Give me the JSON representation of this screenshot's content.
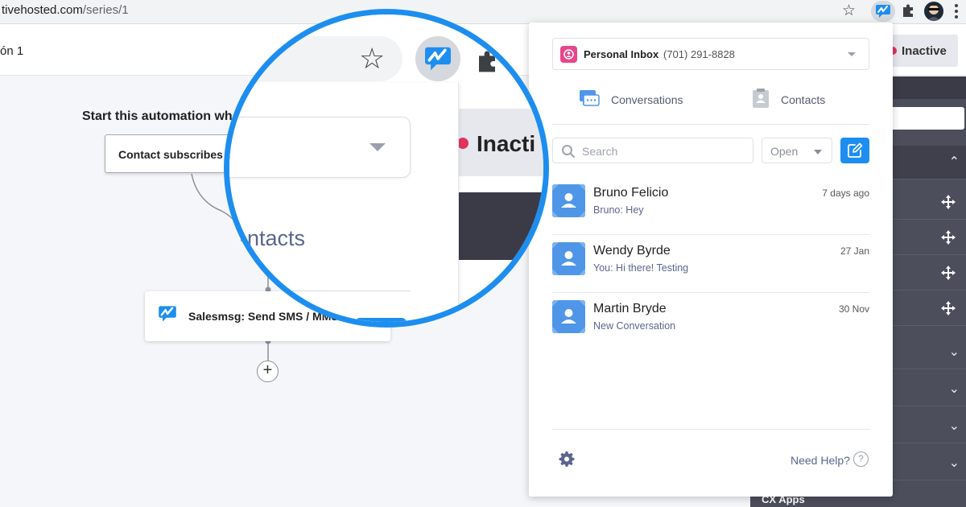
{
  "browser": {
    "url_host": "tivehosted.com",
    "url_path": "/series/1"
  },
  "app": {
    "series_title": "ón 1",
    "status_label": "Inactive",
    "sidebar_footer": "CX Apps"
  },
  "canvas": {
    "trigger_heading": "Start this automation wh",
    "trigger_value": "Contact subscribes to",
    "action_label": "Salesmsg: Send SMS / MMS"
  },
  "magnifier": {
    "contacts_fragment": "ontacts",
    "status_fragment": "Inacti"
  },
  "popup": {
    "inbox": {
      "name": "Personal Inbox",
      "phone": "(701) 291-8828"
    },
    "tabs": [
      {
        "label": "Conversations",
        "icon": "chat-icon"
      },
      {
        "label": "Contacts",
        "icon": "contact-card-icon"
      }
    ],
    "search": {
      "placeholder": "Search"
    },
    "status_filter": {
      "value": "Open"
    },
    "conversations": [
      {
        "name": "Bruno Felicio",
        "preview": "Bruno: Hey",
        "time": "7 days ago"
      },
      {
        "name": "Wendy Byrde",
        "preview": "You: Hi there! Testing",
        "time": "27 Jan"
      },
      {
        "name": "Martin Bryde",
        "preview": "New Conversation",
        "time": "30 Nov"
      }
    ],
    "help": {
      "label": "Need Help?",
      "icon_glyph": "?"
    }
  },
  "colors": {
    "accent": "#1d8ef0",
    "inactive_dot": "#e1335e",
    "inbox_icon": "#e7468a",
    "avatar": "#4f96e8",
    "sidebar": "#4d4e5c"
  }
}
